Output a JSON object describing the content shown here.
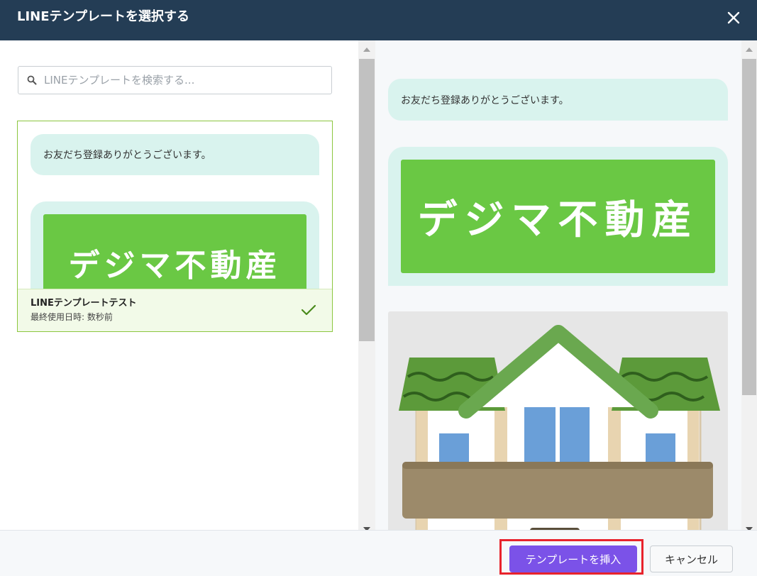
{
  "dialog": {
    "title": "LINEテンプレートを選択する"
  },
  "search": {
    "placeholder": "LINEテンプレートを検索する..."
  },
  "templates": [
    {
      "name": "LINEテンプレートテスト",
      "last_used": "最終使用日時: 数秒前",
      "selected": true,
      "greeting": "お友だち登録ありがとうございます。",
      "logo_text": "デジマ不動産"
    }
  ],
  "preview": {
    "greeting": "お友だち登録ありがとうございます。",
    "logo_text": "デジマ不動産",
    "house_image": "house-illustration"
  },
  "footer": {
    "insert_label": "テンプレートを挿入",
    "cancel_label": "キャンセル"
  },
  "colors": {
    "header_bg": "#243d55",
    "accent": "#7b52e8",
    "selected_border": "#8cc63f",
    "bubble_bg": "#d9f3ee",
    "logo_green": "#6ac844",
    "highlight": "#e8232c"
  }
}
